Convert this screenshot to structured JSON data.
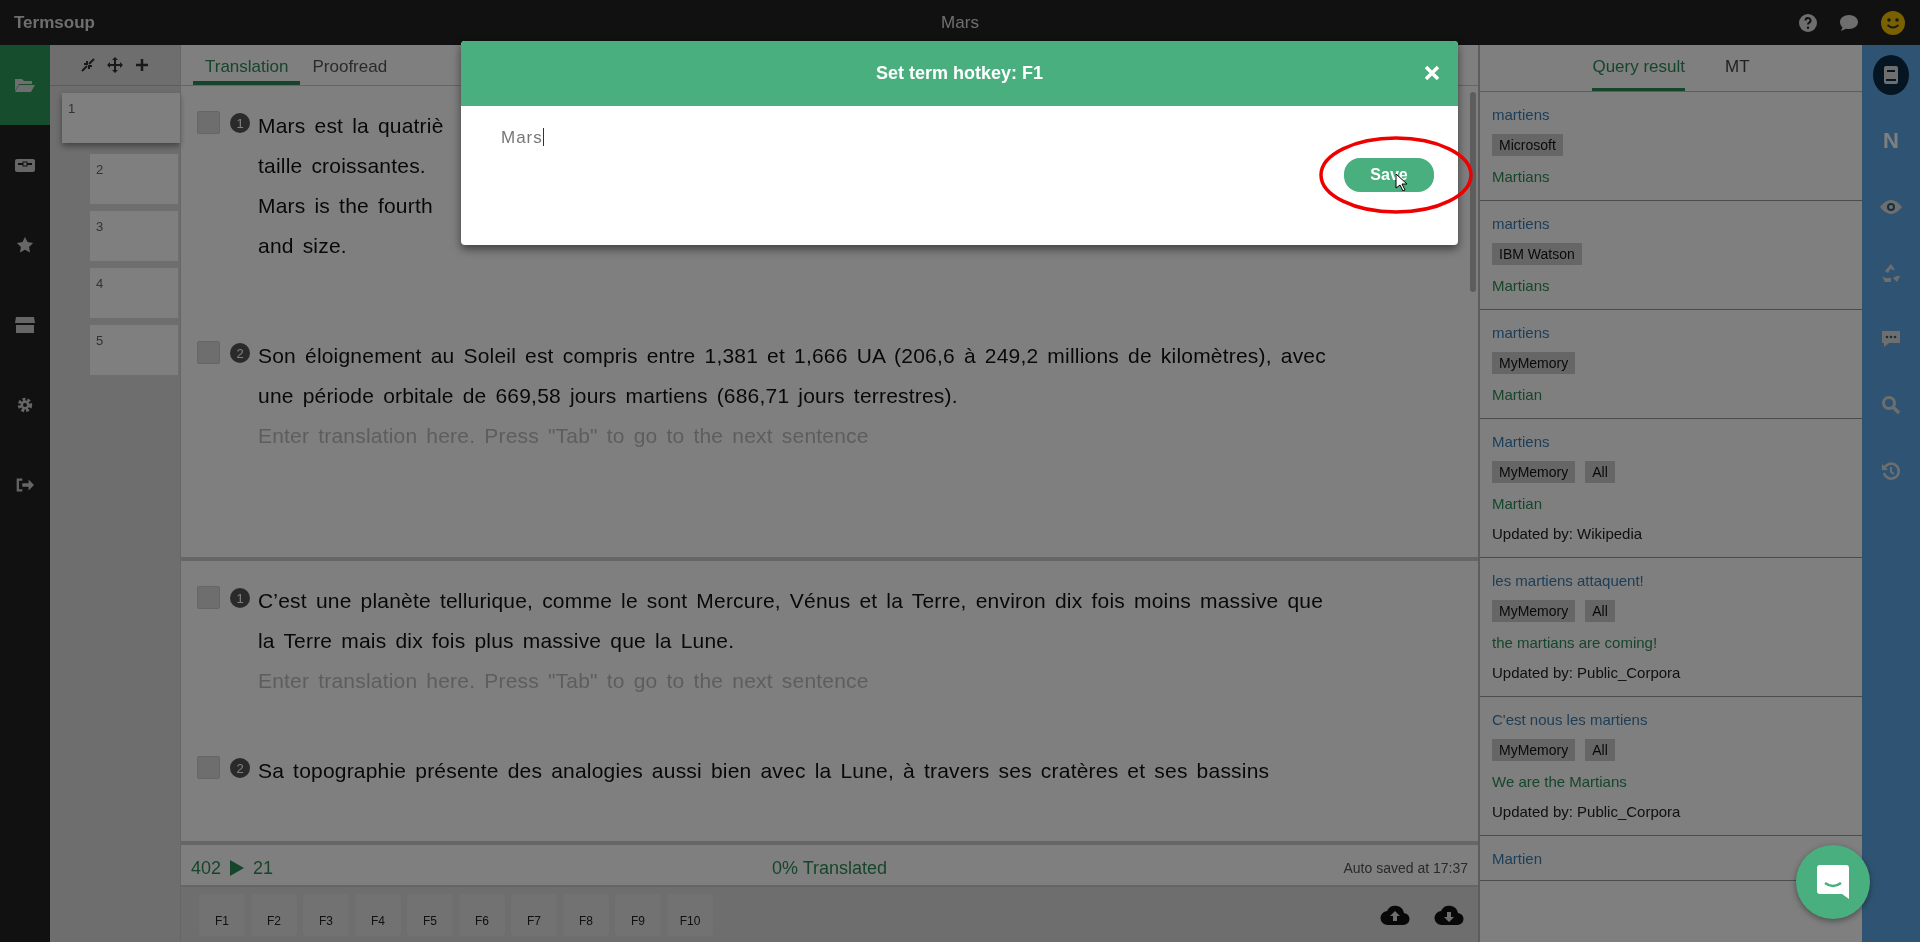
{
  "app": {
    "name": "Termsoup",
    "document_title": "Mars"
  },
  "sidebar": [
    {
      "kind": "folder",
      "selected": true
    },
    {
      "kind": "toolbox",
      "selected": false
    },
    {
      "kind": "star",
      "selected": false
    },
    {
      "kind": "store",
      "selected": false
    },
    {
      "kind": "gear",
      "selected": false
    },
    {
      "kind": "signout",
      "selected": false
    }
  ],
  "segment_nav": [
    {
      "label": "1",
      "selected": true
    },
    {
      "label": "2",
      "selected": false
    },
    {
      "label": "3",
      "selected": false
    },
    {
      "label": "4",
      "selected": false
    },
    {
      "label": "5",
      "selected": false
    }
  ],
  "tabs": [
    {
      "label": "Translation",
      "selected": true
    },
    {
      "label": "Proofread",
      "selected": false
    }
  ],
  "groups": [
    {
      "segments": [
        {
          "number": "1",
          "checked": false,
          "source_lines": [
            "Mars est la quatriè",
            "taille croissantes."
          ],
          "translation_lines": [
            "Mars is the fourth",
            "and size."
          ]
        },
        {
          "number": "2",
          "checked": false,
          "source_lines": [
            "Son éloignement au Soleil est compris entre 1,381 et 1,666 UA (206,6 à 249,2 millions de kilomètres), avec",
            "une période orbitale de 669,58 jours martiens (686,71 jours terrestres)."
          ],
          "placeholder": "Enter translation here. Press \"Tab\" to go to the next sentence"
        }
      ]
    },
    {
      "segments": [
        {
          "number": "1",
          "checked": false,
          "source_lines": [
            "C’est une planète tellurique, comme le sont Mercure, Vénus et la Terre, environ dix fois moins massive que",
            "la Terre mais dix fois plus massive que la Lune."
          ],
          "placeholder": "Enter translation here. Press \"Tab\" to go to the next sentence"
        },
        {
          "number": "2",
          "checked": false,
          "source_lines": [
            "Sa topographie présente des analogies aussi bien avec la Lune, à travers ses cratères et ses bassins"
          ]
        }
      ]
    }
  ],
  "status": {
    "source_count": "402",
    "target_count": "21",
    "progress": "0% Translated",
    "autosave": "Auto saved at 17:37"
  },
  "hotkeys": [
    "F1",
    "F2",
    "F3",
    "F4",
    "F5",
    "F6",
    "F7",
    "F8",
    "F9",
    "F10"
  ],
  "results_tabs": [
    {
      "label": "Query result",
      "selected": true
    },
    {
      "label": "MT",
      "selected": false
    }
  ],
  "results": [
    {
      "source": "martiens",
      "tags": [
        "Microsoft"
      ],
      "target": "Martians"
    },
    {
      "source": "martiens",
      "tags": [
        "IBM Watson"
      ],
      "target": "Martians"
    },
    {
      "source": "martiens",
      "tags": [
        "MyMemory"
      ],
      "target": "Martian"
    },
    {
      "source": "Martiens",
      "tags": [
        "MyMemory",
        "All"
      ],
      "target": "Martian",
      "updated_by": "Updated by: Wikipedia"
    },
    {
      "source": "les martiens attaquent!",
      "tags": [
        "MyMemory",
        "All"
      ],
      "target": "the martians are coming!",
      "updated_by": "Updated by: Public_Corpora"
    },
    {
      "source": "C'est nous les martiens",
      "tags": [
        "MyMemory",
        "All"
      ],
      "target": "We are the Martians",
      "updated_by": "Updated by: Public_Corpora"
    },
    {
      "source": "Martien"
    }
  ],
  "rail": [
    {
      "kind": "book",
      "selected": true
    },
    {
      "kind": "letter",
      "label": "N",
      "selected": false
    },
    {
      "kind": "eye",
      "selected": false
    },
    {
      "kind": "recycle",
      "selected": false
    },
    {
      "kind": "comment",
      "selected": false
    },
    {
      "kind": "search",
      "selected": false
    },
    {
      "kind": "history",
      "selected": false
    }
  ],
  "modal": {
    "title": "Set term hotkey: F1",
    "value": "Mars",
    "save": "Save"
  }
}
